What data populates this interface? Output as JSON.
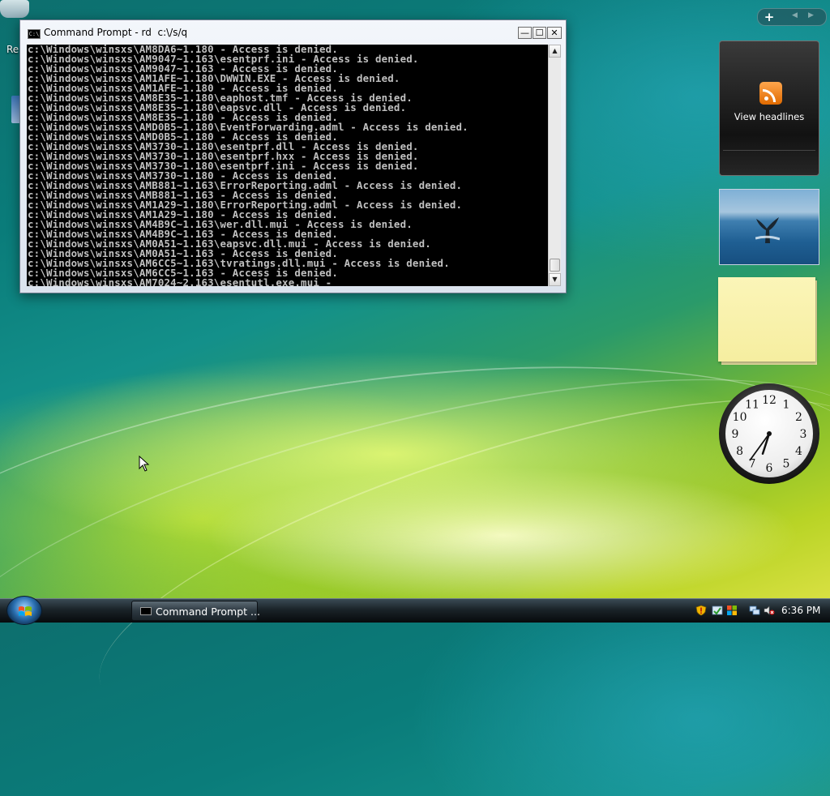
{
  "desktop": {
    "recycle_bin_label": "Re"
  },
  "cmd_window": {
    "title": "Command Prompt - rd  c:\\/s/q",
    "min_label": "—",
    "max_label": "☐",
    "close_label": "✕",
    "lines": [
      "c:\\Windows\\winsxs\\AM8DA6~1.180 - Access is denied.",
      "c:\\Windows\\winsxs\\AM9047~1.163\\esentprf.ini - Access is denied.",
      "c:\\Windows\\winsxs\\AM9047~1.163 - Access is denied.",
      "c:\\Windows\\winsxs\\AM1AFE~1.180\\DWWIN.EXE - Access is denied.",
      "c:\\Windows\\winsxs\\AM1AFE~1.180 - Access is denied.",
      "c:\\Windows\\winsxs\\AM8E35~1.180\\eaphost.tmf - Access is denied.",
      "c:\\Windows\\winsxs\\AM8E35~1.180\\eapsvc.dll - Access is denied.",
      "c:\\Windows\\winsxs\\AM8E35~1.180 - Access is denied.",
      "c:\\Windows\\winsxs\\AMD0B5~1.180\\EventForwarding.adml - Access is denied.",
      "c:\\Windows\\winsxs\\AMD0B5~1.180 - Access is denied.",
      "c:\\Windows\\winsxs\\AM3730~1.180\\esentprf.dll - Access is denied.",
      "c:\\Windows\\winsxs\\AM3730~1.180\\esentprf.hxx - Access is denied.",
      "c:\\Windows\\winsxs\\AM3730~1.180\\esentprf.ini - Access is denied.",
      "c:\\Windows\\winsxs\\AM3730~1.180 - Access is denied.",
      "c:\\Windows\\winsxs\\AMB881~1.163\\ErrorReporting.adml - Access is denied.",
      "c:\\Windows\\winsxs\\AMB881~1.163 - Access is denied.",
      "c:\\Windows\\winsxs\\AM1A29~1.180\\ErrorReporting.adml - Access is denied.",
      "c:\\Windows\\winsxs\\AM1A29~1.180 - Access is denied.",
      "c:\\Windows\\winsxs\\AM4B9C~1.163\\wer.dll.mui - Access is denied.",
      "c:\\Windows\\winsxs\\AM4B9C~1.163 - Access is denied.",
      "c:\\Windows\\winsxs\\AM0A51~1.163\\eapsvc.dll.mui - Access is denied.",
      "c:\\Windows\\winsxs\\AM0A51~1.163 - Access is denied.",
      "c:\\Windows\\winsxs\\AM6CC5~1.163\\tvratings.dll.mui - Access is denied.",
      "c:\\Windows\\winsxs\\AM6CC5~1.163 - Access is denied.",
      "c:\\Windows\\winsxs\\AM7024~2.163\\esentutl.exe.mui -"
    ],
    "scroll_up": "▲",
    "scroll_down": "▼"
  },
  "sidebar": {
    "add_gadget": "+",
    "prev": "◀",
    "next": "▶",
    "feeds_label": "View headlines"
  },
  "clock": {
    "numerals": [
      "12",
      "1",
      "2",
      "3",
      "4",
      "5",
      "6",
      "7",
      "8",
      "9",
      "10",
      "11"
    ],
    "hour": 6,
    "minute": 36
  },
  "taskbar": {
    "task_label": "Command Prompt ...",
    "time": "6:36 PM"
  },
  "colors": {
    "console_bg": "#000000",
    "console_text": "#c0c0c0",
    "rss_orange": "#f28c28"
  }
}
